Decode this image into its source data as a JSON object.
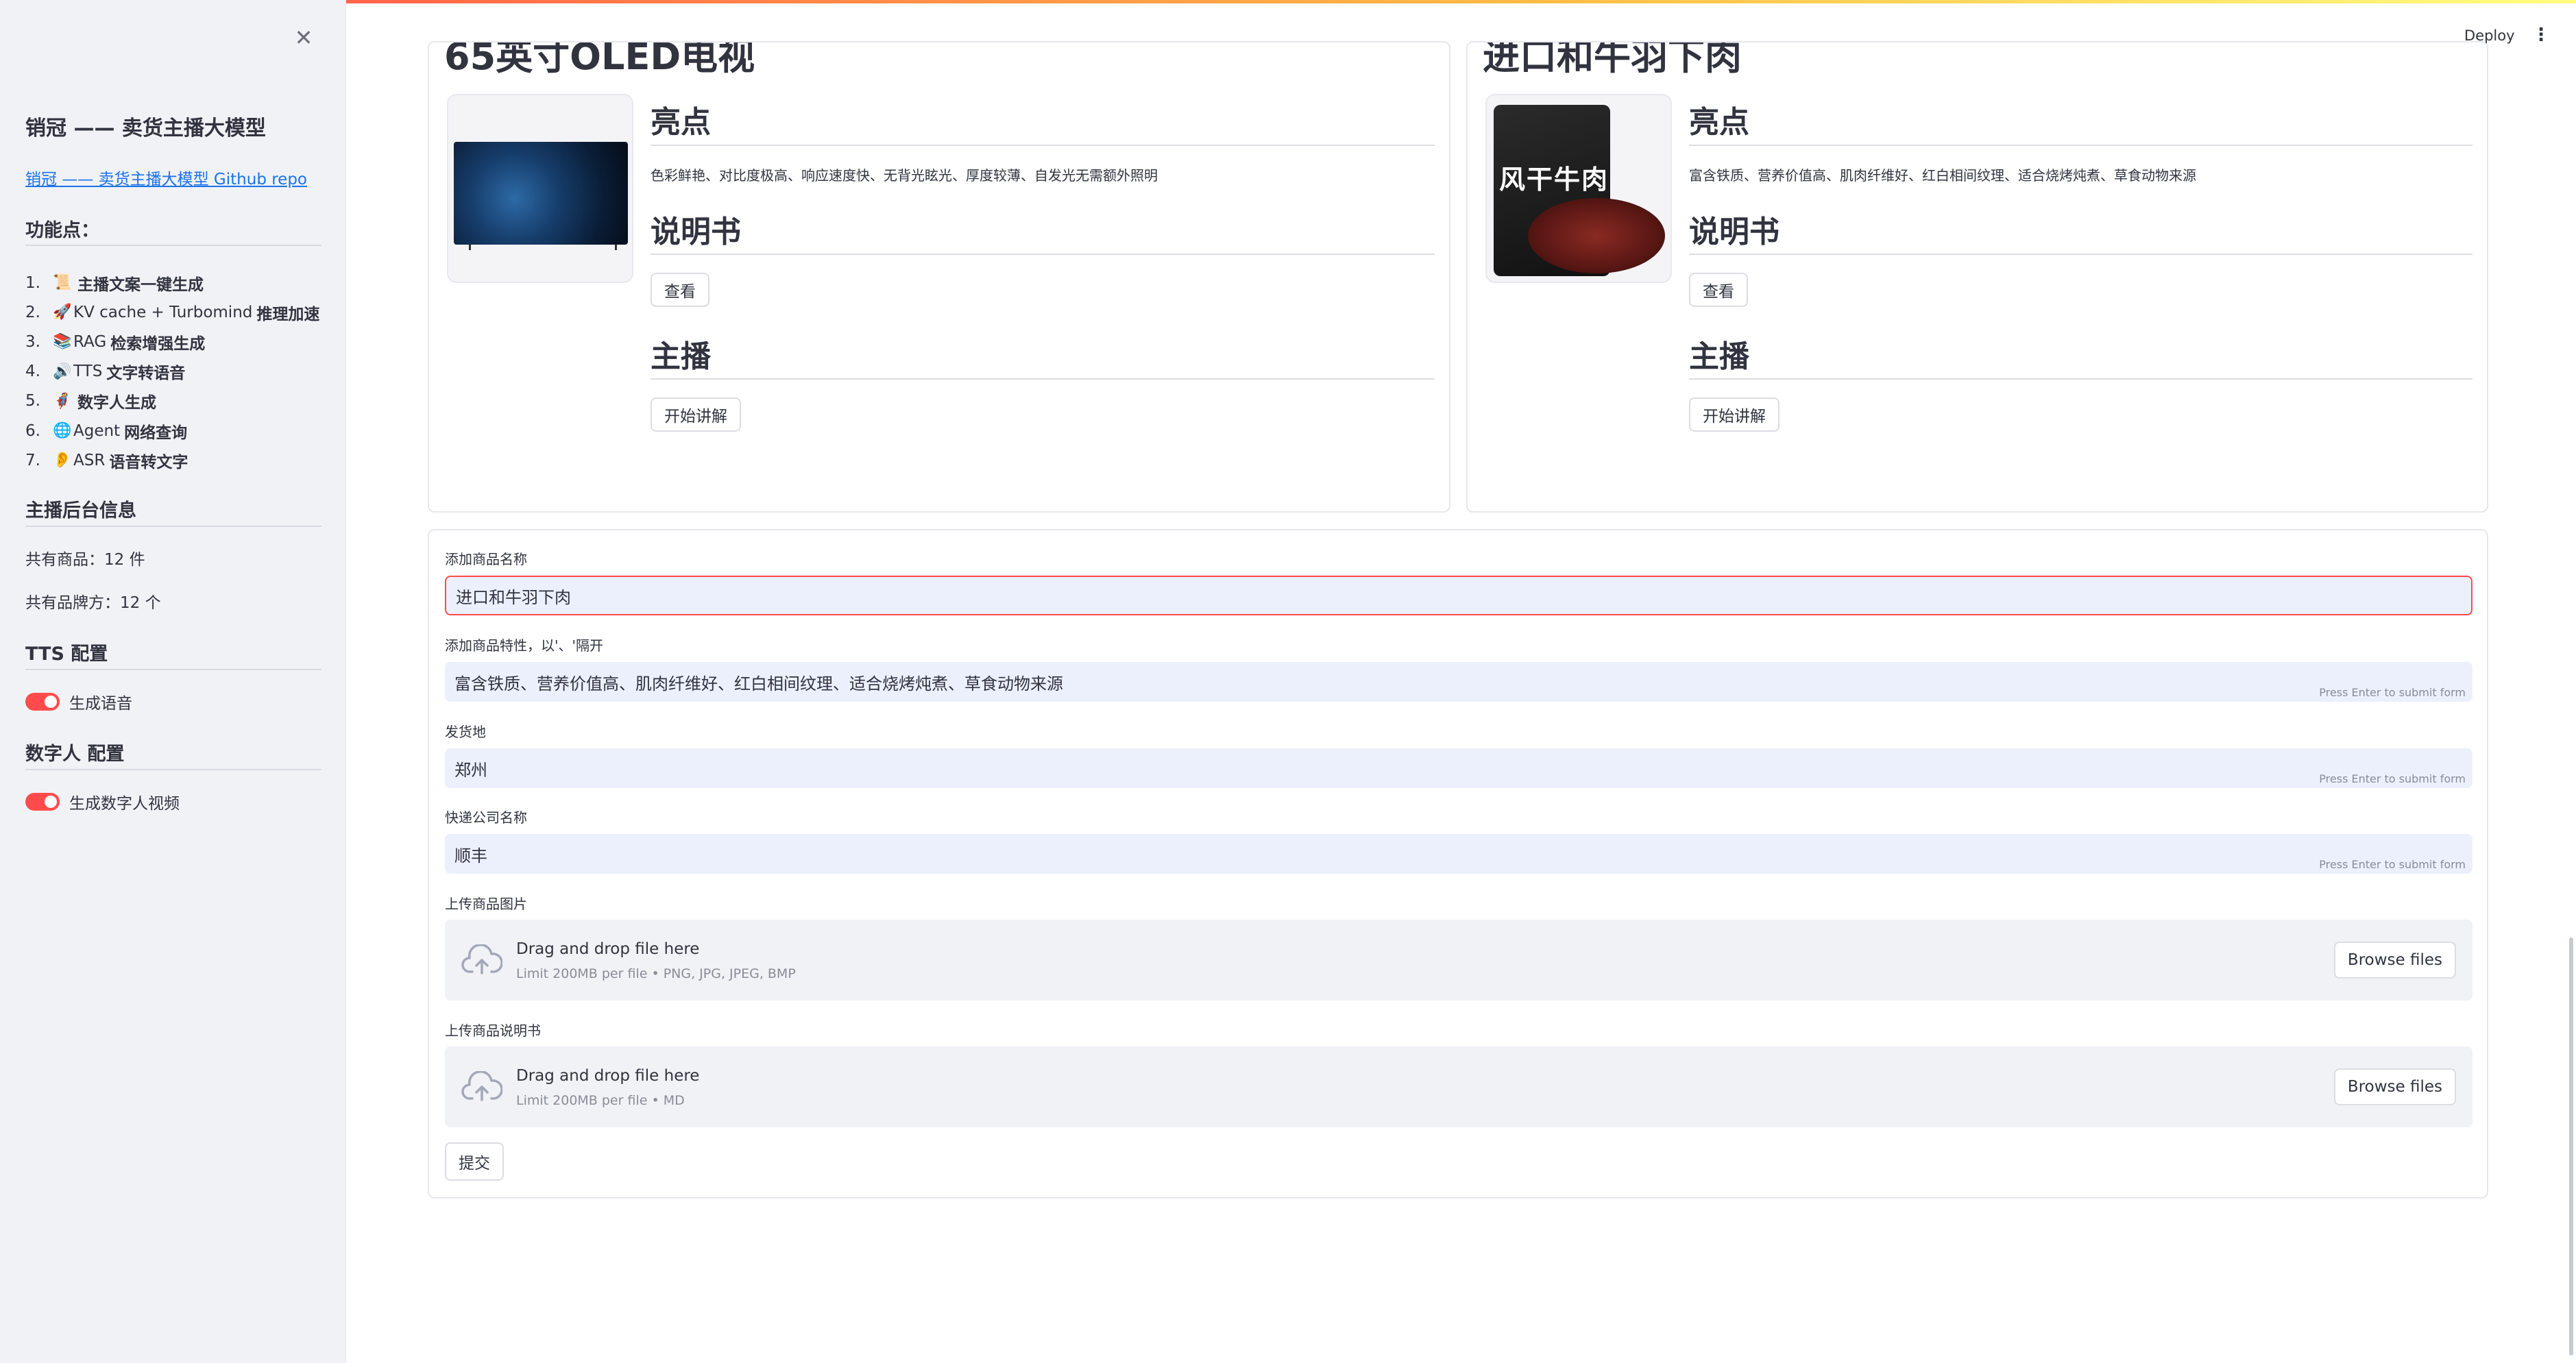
{
  "sidebar": {
    "title": "销冠 —— 卖货主播大模型",
    "link": "销冠 —— 卖货主播大模型 Github repo",
    "features_heading": "功能点：",
    "features": [
      {
        "num": "1.",
        "icon": "scroll-icon",
        "glyph": "📜",
        "plain": "",
        "bold": "主播文案一键生成"
      },
      {
        "num": "2.",
        "icon": "rocket-icon",
        "glyph": "🚀",
        "plain": "KV cache + Turbomind",
        "bold": "推理加速"
      },
      {
        "num": "3.",
        "icon": "books-icon",
        "glyph": "📚",
        "plain": "RAG",
        "bold": "检索增强生成"
      },
      {
        "num": "4.",
        "icon": "speaker-icon",
        "glyph": "🔊",
        "plain": "TTS",
        "bold": "文字转语音"
      },
      {
        "num": "5.",
        "icon": "person-icon",
        "glyph": "🦸",
        "plain": "",
        "bold": "数字人生成"
      },
      {
        "num": "6.",
        "icon": "globe-icon",
        "glyph": "🌐",
        "plain": "Agent",
        "bold": "网络查询"
      },
      {
        "num": "7.",
        "icon": "ear-icon",
        "glyph": "👂",
        "plain": "ASR",
        "bold": "语音转文字"
      }
    ],
    "backend_heading": "主播后台信息",
    "product_count": "共有商品：12 件",
    "brand_count": "共有品牌方：12 个",
    "tts_heading": "TTS 配置",
    "tts_toggle": "生成语音",
    "avatar_heading": "数字人 配置",
    "avatar_toggle": "生成数字人视频"
  },
  "header": {
    "deploy": "Deploy",
    "menu_glyph": "⋮"
  },
  "cards": [
    {
      "title": "65英寸OLED电视",
      "highlights_heading": "亮点",
      "highlights": "色彩鲜艳、对比度极高、响应速度快、无背光眩光、厚度较薄、自发光无需额外照明",
      "manual_heading": "说明书",
      "view_label": "查看",
      "host_heading": "主播",
      "start_label": "开始讲解"
    },
    {
      "title": "进口和牛羽下肉",
      "image_text": "风干牛肉",
      "highlights_heading": "亮点",
      "highlights": "富含铁质、营养价值高、肌肉纤维好、红白相间纹理、适合烧烤炖煮、草食动物来源",
      "manual_heading": "说明书",
      "view_label": "查看",
      "host_heading": "主播",
      "start_label": "开始讲解"
    }
  ],
  "form": {
    "name_label": "添加商品名称",
    "name_value": "进口和牛羽下肉",
    "features_label": "添加商品特性，以'、'隔开",
    "features_value": "富含铁质、营养价值高、肌肉纤维好、红白相间纹理、适合烧烤炖煮、草食动物来源",
    "origin_label": "发货地",
    "origin_value": "郑州",
    "courier_label": "快递公司名称",
    "courier_value": "顺丰",
    "hint": "Press Enter to submit form",
    "image_upload_label": "上传商品图片",
    "image_drop": "Drag and drop file here",
    "image_limit": "Limit 200MB per file • PNG, JPG, JPEG, BMP",
    "manual_upload_label": "上传商品说明书",
    "manual_drop": "Drag and drop file here",
    "manual_limit": "Limit 200MB per file • MD",
    "browse": "Browse files",
    "submit": "提交"
  },
  "colors": {
    "accent": "#ff4b4b",
    "link": "#1a73e8",
    "input_bg": "#ebf0fc",
    "sidebar_bg": "#f0f2f6"
  }
}
